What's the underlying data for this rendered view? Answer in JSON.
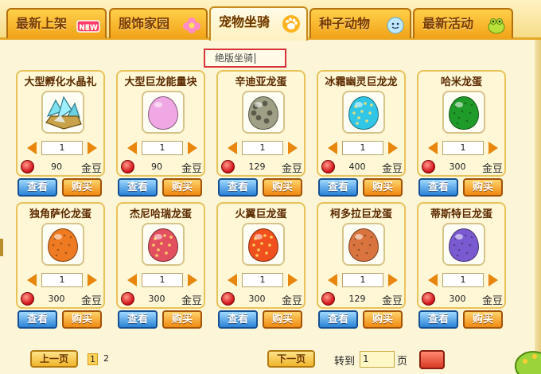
{
  "tabs": [
    {
      "label": "最新上架",
      "badge": "NEW",
      "icon": "new-badge-icon"
    },
    {
      "label": "服饰家园",
      "icon": "pink-flower-icon"
    },
    {
      "label": "宠物坐骑",
      "icon": "paw-print-icon",
      "active": true
    },
    {
      "label": "种子动物",
      "icon": "blue-smiley-icon"
    },
    {
      "label": "最新活动",
      "icon": "green-frog-icon"
    }
  ],
  "search": {
    "value": "绝版坐骑"
  },
  "card_common": {
    "unit": "金豆",
    "view_label": "查看",
    "buy_label": "购买"
  },
  "items": [
    {
      "name": "大型孵化水晶礼",
      "qty": "1",
      "price": "90",
      "art": "crystal"
    },
    {
      "name": "大型巨龙能量块",
      "qty": "1",
      "price": "90",
      "egg_color": "#f0a8e4",
      "pattern": "plain"
    },
    {
      "name": "辛迪亚龙蛋",
      "qty": "1",
      "price": "129",
      "egg_color": "#9f9f86",
      "pattern": "spots-dark"
    },
    {
      "name": "冰霜幽灵巨龙龙",
      "qty": "1",
      "price": "400",
      "egg_color": "#32c6e6",
      "pattern": "spots-light"
    },
    {
      "name": "哈米龙蛋",
      "qty": "1",
      "price": "300",
      "egg_color": "#1f9b2a",
      "pattern": "speckle"
    },
    {
      "name": "独角萨伦龙蛋",
      "qty": "1",
      "price": "300",
      "egg_color": "#ee7a22",
      "pattern": "speckle"
    },
    {
      "name": "杰尼哈瑞龙蛋",
      "qty": "1",
      "price": "300",
      "egg_color": "#e25060",
      "pattern": "spots-light"
    },
    {
      "name": "火翼巨龙蛋",
      "qty": "1",
      "price": "300",
      "egg_color": "#f0501e",
      "pattern": "spots-light"
    },
    {
      "name": "柯多拉巨龙蛋",
      "qty": "1",
      "price": "129",
      "egg_color": "#d9743e",
      "pattern": "speckle"
    },
    {
      "name": "蒂斯特巨龙蛋",
      "qty": "1",
      "price": "300",
      "egg_color": "#7a5ad0",
      "pattern": "speckle"
    }
  ],
  "pagination": {
    "prev_label": "上一页",
    "next_label": "下一页",
    "pages": [
      "1",
      "2"
    ],
    "current": "1",
    "goto_label": "转到",
    "goto_value": "1",
    "page_suffix": "页"
  },
  "colors": {
    "accent": "#f2a318",
    "tab_border": "#b4700d",
    "view_button": "#2b83d6",
    "buy_button": "#f08a12",
    "search_border": "#d9333a"
  }
}
